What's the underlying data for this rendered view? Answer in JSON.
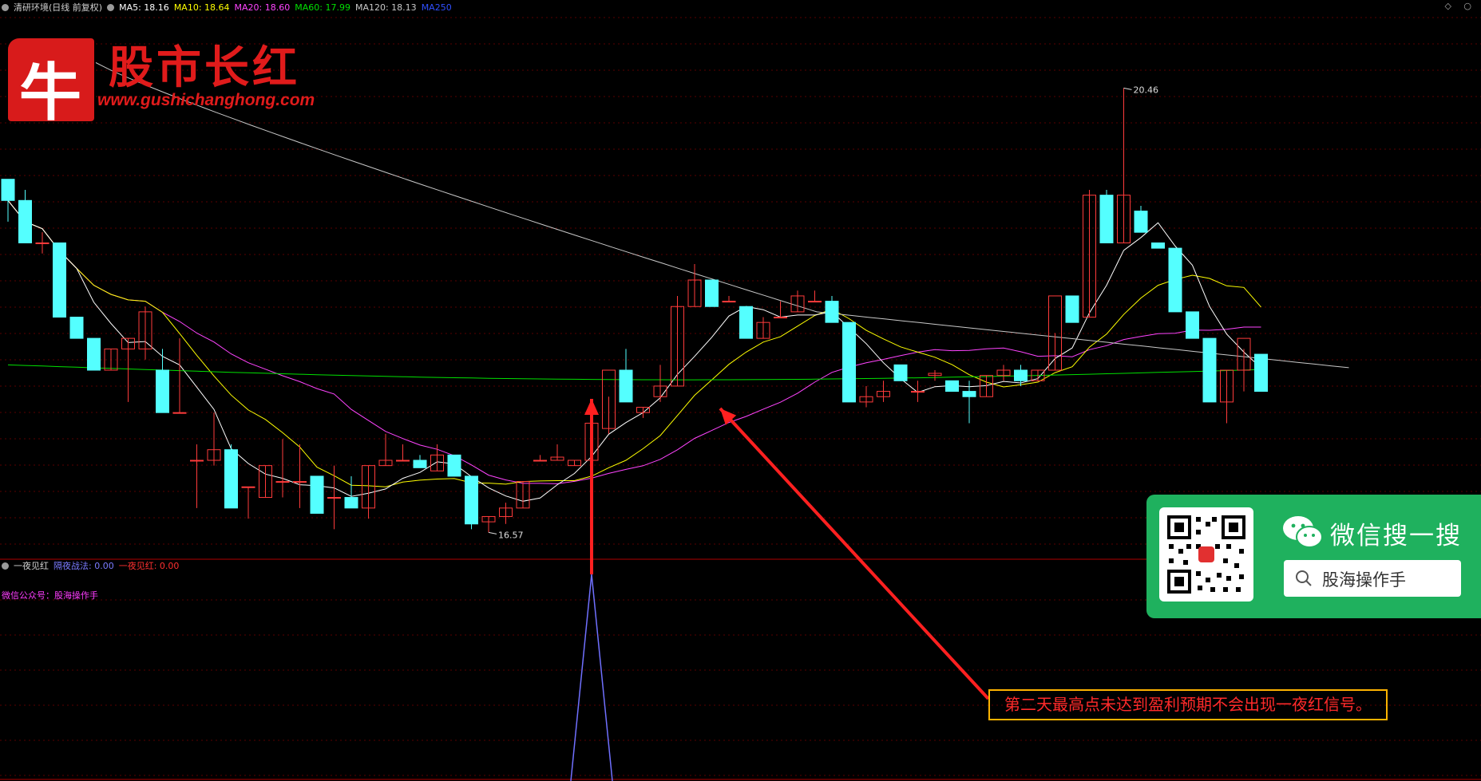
{
  "header": {
    "title": "清研环境(日线 前复权)",
    "ma5": "MA5: 18.16",
    "ma10": "MA10: 18.64",
    "ma20": "MA20: 18.60",
    "ma60": "MA60: 17.99",
    "ma120": "MA120: 18.13",
    "ma250": "MA250",
    "window_controls": "◇ ○"
  },
  "indicator": {
    "name": "一夜见红",
    "label1": "隔夜战法: 0.00",
    "label2": "一夜见红: 0.00",
    "note": "微信公众号：股海操作手"
  },
  "logo": {
    "glyph": "牛",
    "title": "股市长红",
    "url": "www.gushichanghong.com"
  },
  "wechat": {
    "title": "微信搜一搜",
    "search_text": "股海操作手"
  },
  "annotation": "第二天最高点未达到盈利预期不会出现一夜红信号。",
  "colors": {
    "background": "#000000",
    "up": "#ff3b3b",
    "down": "#54ffff",
    "ma5": "#ffffff",
    "ma10": "#ffff00",
    "ma20": "#ff44ff",
    "ma60": "#00e000",
    "ma120": "#c8c8c8",
    "ma250": "#3050ff",
    "signal": "#7070ff",
    "arrow": "#ff2020",
    "wechat_green": "#1fb15e",
    "note_border": "#ffb300"
  },
  "chart_data": {
    "type": "candlestick",
    "ylim": [
      16.1,
      21.2
    ],
    "labels": {
      "high": "20.46",
      "low": "16.57"
    },
    "ohlc": [
      [
        19.6,
        19.6,
        19.2,
        19.4
      ],
      [
        19.4,
        19.5,
        19.0,
        19.0
      ],
      [
        19.0,
        19.1,
        18.9,
        19.0
      ],
      [
        19.0,
        19.0,
        18.3,
        18.3
      ],
      [
        18.3,
        18.3,
        18.1,
        18.1
      ],
      [
        18.1,
        18.1,
        17.8,
        17.8
      ],
      [
        17.8,
        18.0,
        17.8,
        18.0
      ],
      [
        18.0,
        18.1,
        17.5,
        18.1
      ],
      [
        18.0,
        18.4,
        17.9,
        18.35
      ],
      [
        17.8,
        18.0,
        17.4,
        17.4
      ],
      [
        17.4,
        18.1,
        17.4,
        17.4
      ],
      [
        16.95,
        17.1,
        16.5,
        16.95
      ],
      [
        16.95,
        17.4,
        16.9,
        17.05
      ],
      [
        17.05,
        17.1,
        16.5,
        16.5
      ],
      [
        16.7,
        16.7,
        16.4,
        16.7
      ],
      [
        16.6,
        16.9,
        16.6,
        16.9
      ],
      [
        16.75,
        17.15,
        16.6,
        16.75
      ],
      [
        16.75,
        17.1,
        16.5,
        16.75
      ],
      [
        16.8,
        16.8,
        16.45,
        16.45
      ],
      [
        16.6,
        16.9,
        16.3,
        16.6
      ],
      [
        16.6,
        16.8,
        16.5,
        16.5
      ],
      [
        16.5,
        16.9,
        16.4,
        16.9
      ],
      [
        16.9,
        17.2,
        16.9,
        16.95
      ],
      [
        16.95,
        17.1,
        16.95,
        16.95
      ],
      [
        16.95,
        17.0,
        16.88,
        16.88
      ],
      [
        16.85,
        17.1,
        16.85,
        17.0
      ],
      [
        17.0,
        17.0,
        16.8,
        16.8
      ],
      [
        16.8,
        16.8,
        16.3,
        16.35
      ],
      [
        16.37,
        16.42,
        16.27,
        16.42
      ],
      [
        16.42,
        16.55,
        16.35,
        16.5
      ],
      [
        16.5,
        16.75,
        16.5,
        16.75
      ],
      [
        16.95,
        17.0,
        16.95,
        16.95
      ],
      [
        16.95,
        17.1,
        16.95,
        16.98
      ],
      [
        16.9,
        16.95,
        16.9,
        16.95
      ],
      [
        16.95,
        17.3,
        16.9,
        17.3
      ],
      [
        17.25,
        17.55,
        17.2,
        17.8
      ],
      [
        17.8,
        18.0,
        17.5,
        17.5
      ],
      [
        17.4,
        17.45,
        17.35,
        17.45
      ],
      [
        17.55,
        17.85,
        17.5,
        17.65
      ],
      [
        17.65,
        18.5,
        17.65,
        18.4
      ],
      [
        18.4,
        18.8,
        18.4,
        18.65
      ],
      [
        18.65,
        18.65,
        18.4,
        18.4
      ],
      [
        18.45,
        18.5,
        18.45,
        18.45
      ],
      [
        18.4,
        18.4,
        18.1,
        18.1
      ],
      [
        18.1,
        18.3,
        18.1,
        18.25
      ],
      [
        18.3,
        18.45,
        18.3,
        18.3
      ],
      [
        18.35,
        18.55,
        18.35,
        18.5
      ],
      [
        18.45,
        18.55,
        18.45,
        18.45
      ],
      [
        18.45,
        18.5,
        18.25,
        18.25
      ],
      [
        18.25,
        18.25,
        17.5,
        17.5
      ],
      [
        17.5,
        17.65,
        17.45,
        17.55
      ],
      [
        17.55,
        17.7,
        17.5,
        17.6
      ],
      [
        17.85,
        17.85,
        17.7,
        17.7
      ],
      [
        17.6,
        17.7,
        17.5,
        17.6
      ],
      [
        17.75,
        17.8,
        17.7,
        17.77
      ],
      [
        17.7,
        17.7,
        17.6,
        17.6
      ],
      [
        17.6,
        17.7,
        17.3,
        17.55
      ],
      [
        17.55,
        17.75,
        17.55,
        17.75
      ],
      [
        17.75,
        17.85,
        17.7,
        17.8
      ],
      [
        17.8,
        17.85,
        17.65,
        17.7
      ],
      [
        17.7,
        17.8,
        17.7,
        17.8
      ],
      [
        17.8,
        18.15,
        17.8,
        18.5
      ],
      [
        18.5,
        18.5,
        18.25,
        18.25
      ],
      [
        18.3,
        19.5,
        18.3,
        19.45
      ],
      [
        19.45,
        19.5,
        19.0,
        19.0
      ],
      [
        19.0,
        20.46,
        19.0,
        19.45
      ],
      [
        19.3,
        19.35,
        19.1,
        19.1
      ],
      [
        19.0,
        19.0,
        18.95,
        18.95
      ],
      [
        18.95,
        18.95,
        18.35,
        18.35
      ],
      [
        18.35,
        18.35,
        18.1,
        18.1
      ],
      [
        18.1,
        18.1,
        17.5,
        17.5
      ],
      [
        17.5,
        17.8,
        17.3,
        17.8
      ],
      [
        17.8,
        18.0,
        17.6,
        18.1
      ],
      [
        17.95,
        17.95,
        17.6,
        17.6
      ]
    ]
  }
}
